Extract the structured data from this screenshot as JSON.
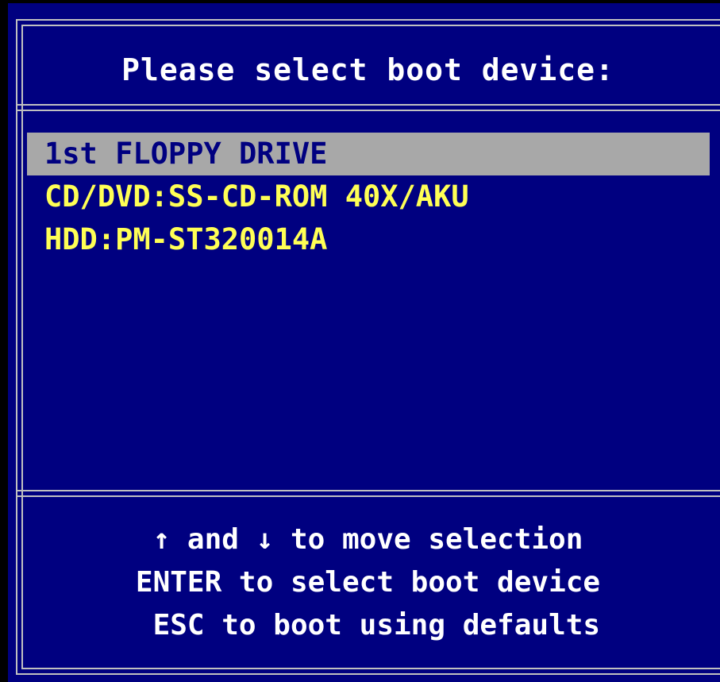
{
  "colors": {
    "background": "#000080",
    "border": "#c0c0c0",
    "title_text": "#ffffff",
    "item_text": "#ffff55",
    "selected_bg": "#a8a8a8",
    "selected_text": "#000080",
    "footer_text": "#ffffff"
  },
  "header": {
    "title": "Please select boot device:"
  },
  "boot_devices": [
    {
      "label": "1st FLOPPY DRIVE",
      "selected": true
    },
    {
      "label": "CD/DVD:SS-CD-ROM 40X/AKU",
      "selected": false
    },
    {
      "label": "HDD:PM-ST320014A",
      "selected": false
    }
  ],
  "footer": {
    "line_move": "↑ and ↓ to move selection",
    "line_enter": "ENTER to select boot device",
    "line_esc": " ESC to boot using defaults"
  }
}
